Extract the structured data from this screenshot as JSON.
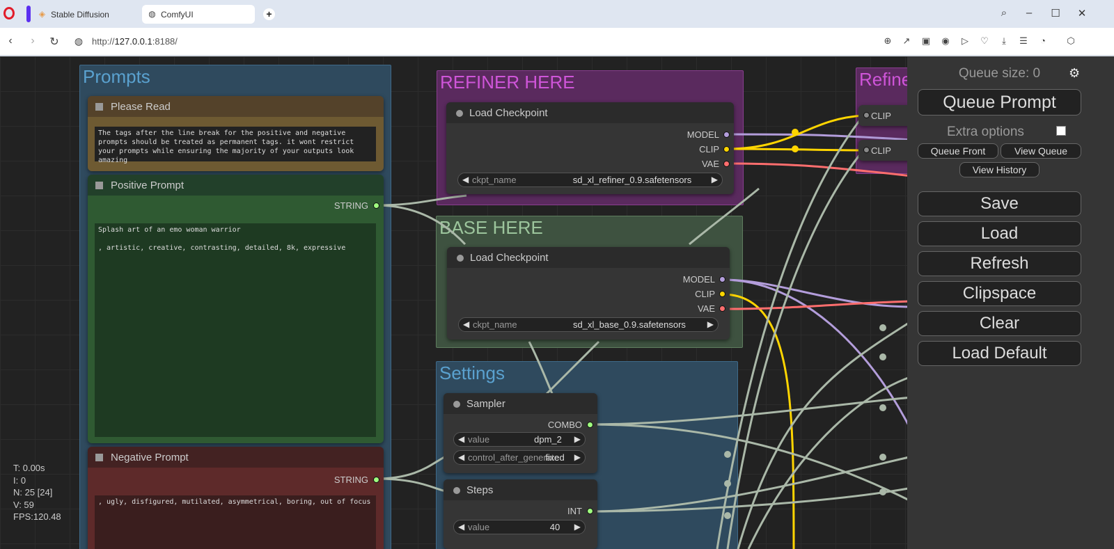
{
  "browser": {
    "tabs": [
      {
        "title": "Stable Diffusion"
      },
      {
        "title": "ComfyUI"
      }
    ],
    "url_scheme": "http://",
    "url_host": "127.0.0.1",
    "url_rest": ":8188/"
  },
  "groups": {
    "prompts": "Prompts",
    "refiner": "REFINER HERE",
    "base": "BASE HERE",
    "settings": "Settings",
    "refine_partial": "Refine"
  },
  "nodes": {
    "please_read": {
      "title": "Please Read",
      "text": "The tags after the line break for the positive and negative prompts should be treated as permanent tags. it wont restrict your prompts while ensuring the majority of your outputs look amazing"
    },
    "positive": {
      "title": "Positive Prompt",
      "output": "STRING",
      "text": "Splash art of an emo woman warrior\n\n, artistic, creative, contrasting, detailed, 8k, expressive"
    },
    "negative": {
      "title": "Negative Prompt",
      "output": "STRING",
      "text": ", ugly, disfigured, mutilated, asymmetrical, boring, out of focus"
    },
    "refiner_ckpt": {
      "title": "Load Checkpoint",
      "outputs": [
        "MODEL",
        "CLIP",
        "VAE"
      ],
      "widget_label": "ckpt_name",
      "widget_value": "sd_xl_refiner_0.9.safetensors"
    },
    "base_ckpt": {
      "title": "Load Checkpoint",
      "outputs": [
        "MODEL",
        "CLIP",
        "VAE"
      ],
      "widget_label": "ckpt_name",
      "widget_value": "sd_xl_base_0.9.safetensors"
    },
    "sampler": {
      "title": "Sampler",
      "output": "COMBO",
      "widgets": [
        {
          "label": "value",
          "value": "dpm_2"
        },
        {
          "label": "control_after_generate",
          "value": "fixed"
        }
      ]
    },
    "steps": {
      "title": "Steps",
      "output": "INT",
      "widget_label": "value",
      "widget_value": "40"
    },
    "refine_clip_1": "CLIP",
    "refine_clip_2": "CLIP"
  },
  "stats": {
    "t": "T: 0.00s",
    "i": "I: 0",
    "n": "N: 25 [24]",
    "v": "V: 59",
    "fps": "FPS:120.48"
  },
  "menu": {
    "queue_size": "Queue size: 0",
    "queue_prompt": "Queue Prompt",
    "extra_options": "Extra options",
    "queue_front": "Queue Front",
    "view_queue": "View Queue",
    "view_history": "View History",
    "save": "Save",
    "load": "Load",
    "refresh": "Refresh",
    "clipspace": "Clipspace",
    "clear": "Clear",
    "load_default": "Load Default"
  },
  "colors": {
    "model": "#b39ddb",
    "clip": "#ffd500",
    "vae": "#ff6e6e",
    "string": "#9fff7f",
    "link": "#aab8a8"
  }
}
